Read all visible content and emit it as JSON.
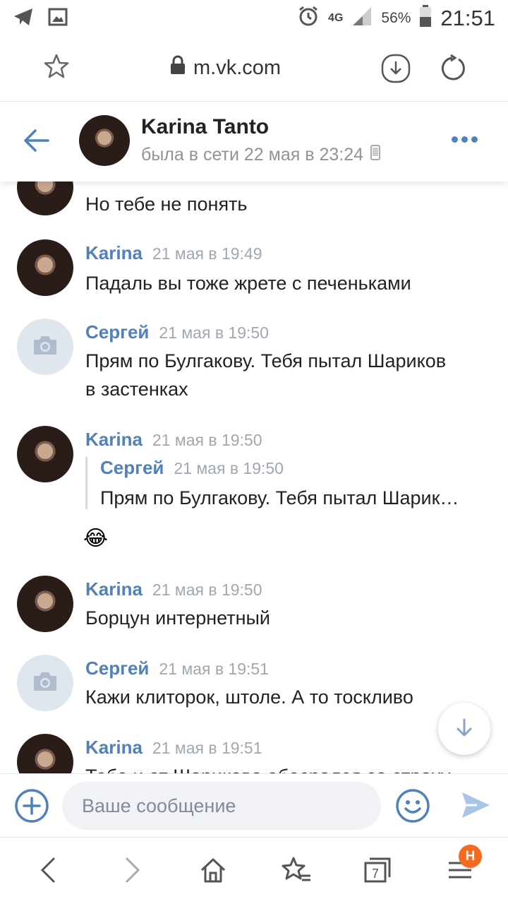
{
  "status_bar": {
    "network": "4G",
    "battery": "56%",
    "time": "21:51"
  },
  "browser": {
    "url": "m.vk.com",
    "badge": "Н"
  },
  "chat": {
    "name": "Karina Tanto",
    "presence": "была в сети 22 мая в 23:24"
  },
  "messages": [
    {
      "type": "continuation",
      "text": "Но тебе не понять"
    },
    {
      "author": "Karina",
      "time": "21 мая в 19:49",
      "text": "Падаль вы тоже жрете с печеньками"
    },
    {
      "author": "Сергей",
      "time": "21 мая в 19:50",
      "text": "Прям по Булгакову. Тебя пытал Шариков в застенках"
    },
    {
      "author": "Karina",
      "time": "21 мая в 19:50",
      "forward": {
        "author": "Сергей",
        "time": "21 мая в 19:50",
        "text": "Прям по Булгакову. Тебя пытал Шарик…"
      },
      "emoji": "😂"
    },
    {
      "author": "Karina",
      "time": "21 мая в 19:50",
      "text": "Борцун интернетный"
    },
    {
      "author": "Сергей",
      "time": "21 мая в 19:51",
      "text": "Кажи клиторок, штоле. А то тоскливо"
    },
    {
      "author": "Karina",
      "time": "21 мая в 19:51",
      "text": "Тебе и от Шарикова обосрался со страху"
    }
  ],
  "composer": {
    "placeholder": "Ваше сообщение"
  },
  "colors": {
    "accent": "#5181b8",
    "badge": "#f26b21"
  },
  "icons": [
    "telegram-icon",
    "gallery-icon",
    "alarm-icon",
    "signal-icon",
    "battery-icon",
    "star-icon",
    "lock-icon",
    "download-icon",
    "reload-icon",
    "back-arrow-icon",
    "more-icon",
    "camera-icon",
    "arrow-down-icon",
    "add-icon",
    "smile-icon",
    "send-icon",
    "nav-back-icon",
    "nav-forward-icon",
    "home-icon",
    "bookmarks-icon",
    "tabs-icon",
    "menu-icon"
  ]
}
